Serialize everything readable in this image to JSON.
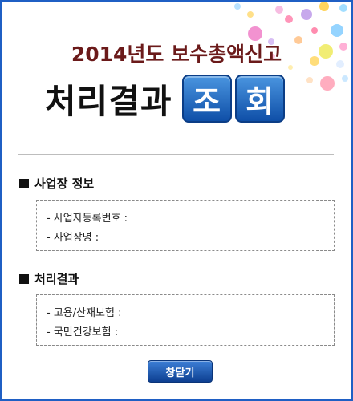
{
  "header": {
    "subtitle": "2014년도 보수총액신고",
    "title_text": "처리결과",
    "title_box_1": "조",
    "title_box_2": "회"
  },
  "sections": {
    "business": {
      "heading": "사업장 정보",
      "rows": [
        "- 사업자등록번호 :",
        "- 사업장명 :"
      ]
    },
    "result": {
      "heading": "처리결과",
      "rows": [
        "- 고용/산재보험 :",
        "- 국민건강보험 :"
      ]
    }
  },
  "buttons": {
    "close_label": "창닫기"
  },
  "colors": {
    "frame": "#1f5fc4",
    "subtitle": "#6b1a1a",
    "title_box": "#1a5fbf",
    "button": "#1a4fa3"
  }
}
